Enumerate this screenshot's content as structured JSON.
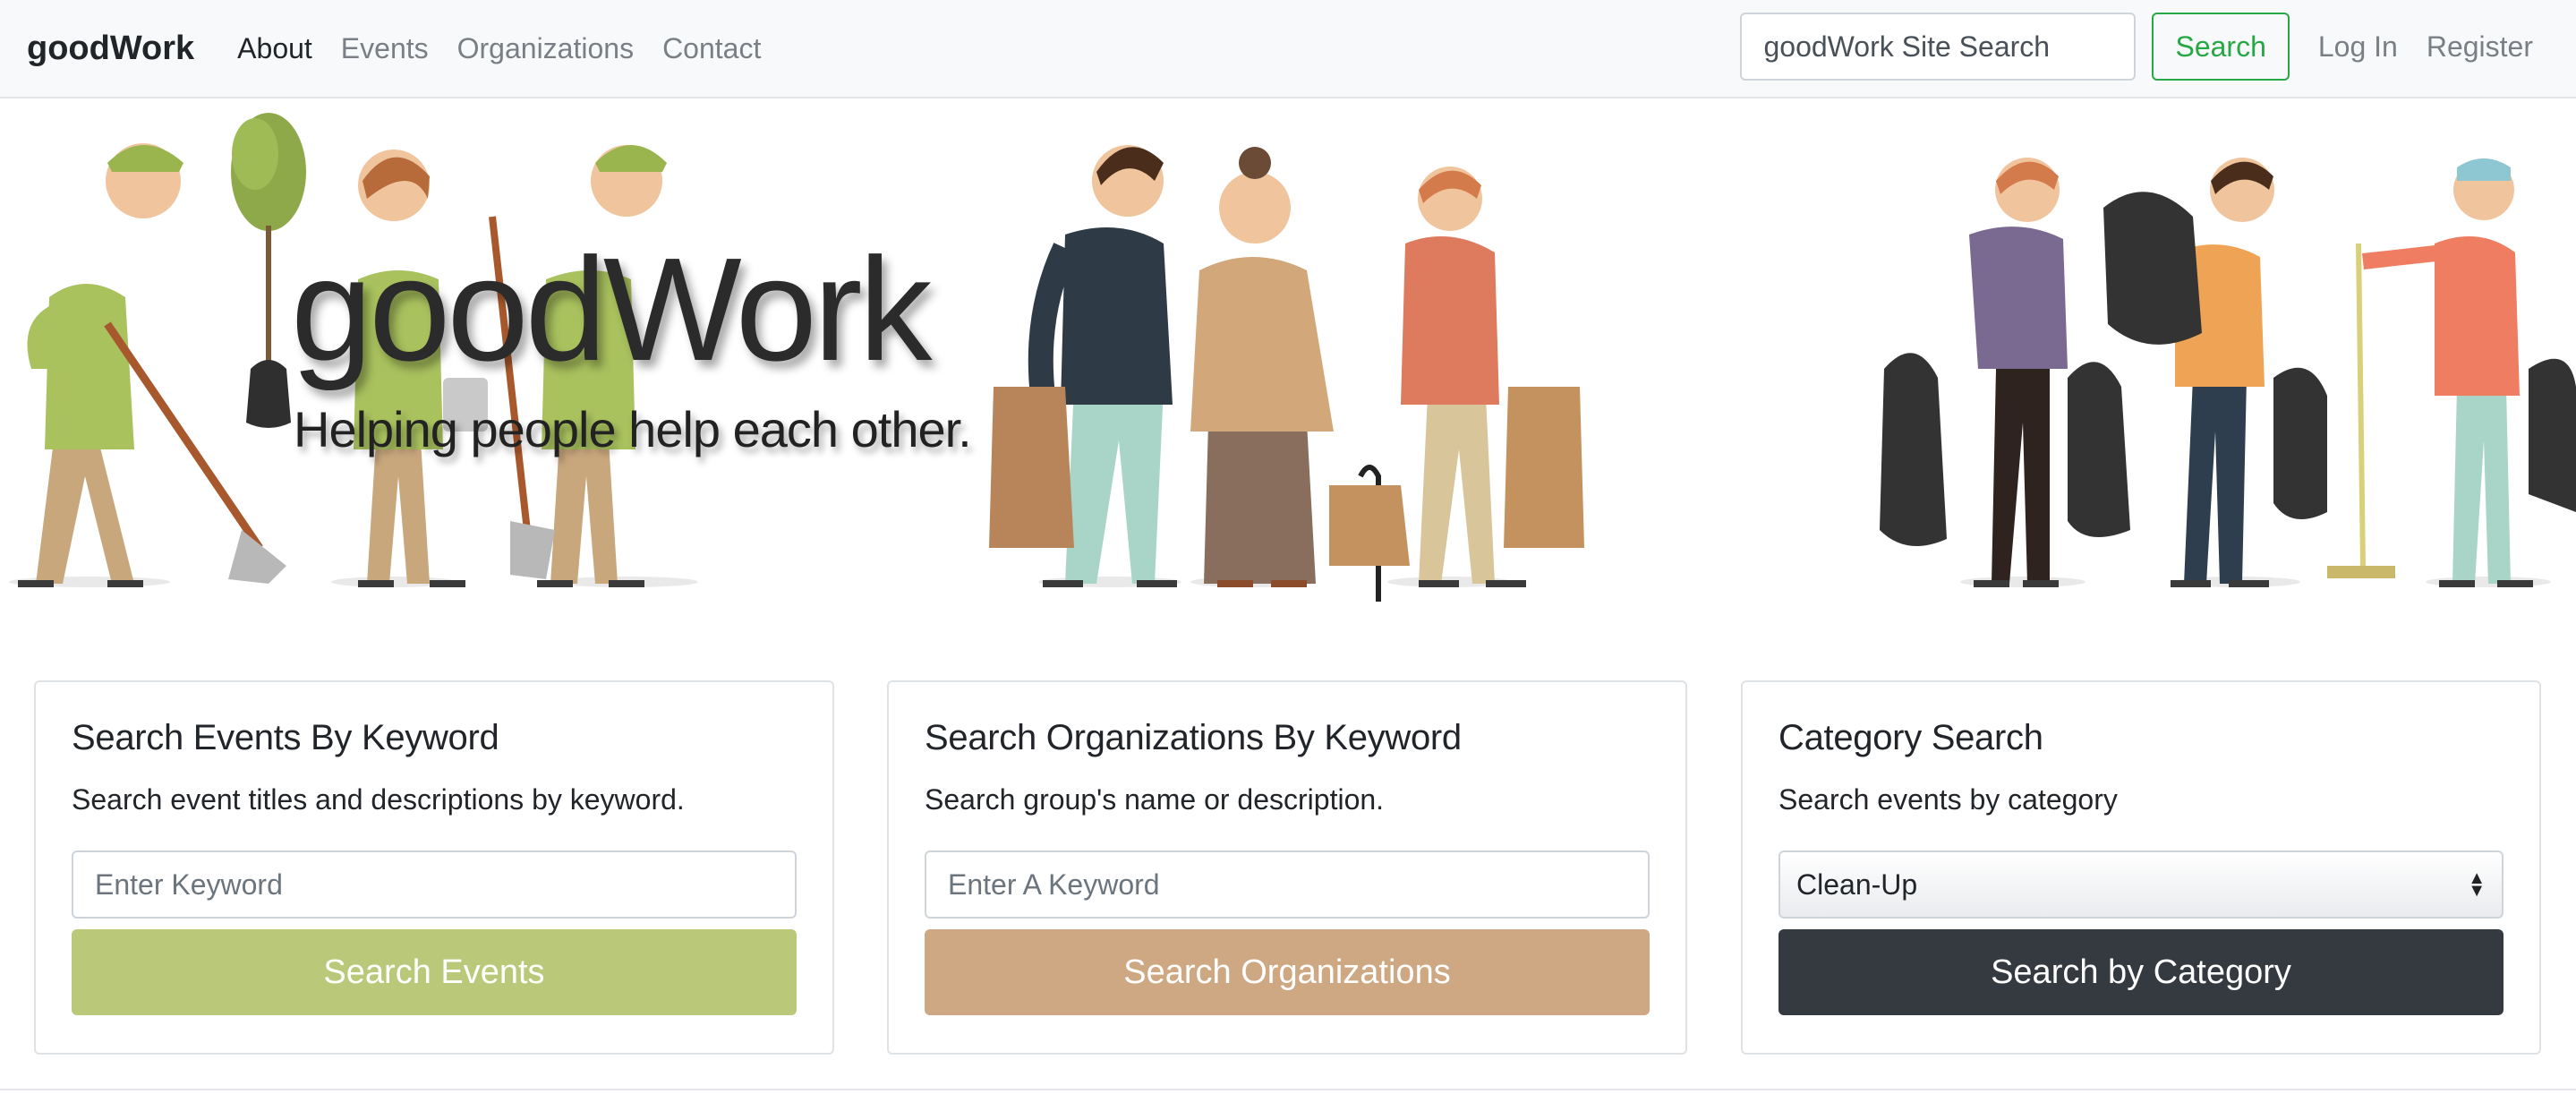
{
  "navbar": {
    "brand": "goodWork",
    "links": [
      {
        "label": "About",
        "active": true
      },
      {
        "label": "Events",
        "active": false
      },
      {
        "label": "Organizations",
        "active": false
      },
      {
        "label": "Contact",
        "active": false
      }
    ],
    "site_search_placeholder": "goodWork Site Search",
    "search_button": "Search",
    "login": "Log In",
    "register": "Register"
  },
  "hero": {
    "title": "goodWork",
    "subtitle": "Helping people help each other."
  },
  "cards": {
    "events": {
      "title": "Search Events By Keyword",
      "text": "Search event titles and descriptions by keyword.",
      "placeholder": "Enter Keyword",
      "button": "Search Events"
    },
    "organizations": {
      "title": "Search Organizations By Keyword",
      "text": "Search group's name or description.",
      "placeholder": "Enter A Keyword",
      "button": "Search Organizations"
    },
    "category": {
      "title": "Category Search",
      "text": "Search events by category",
      "selected": "Clean-Up",
      "button": "Search by Category"
    }
  },
  "colors": {
    "events_button": "#b9c879",
    "organizations_button": "#cda882",
    "category_button": "#343a40",
    "search_outline": "#28a745"
  }
}
